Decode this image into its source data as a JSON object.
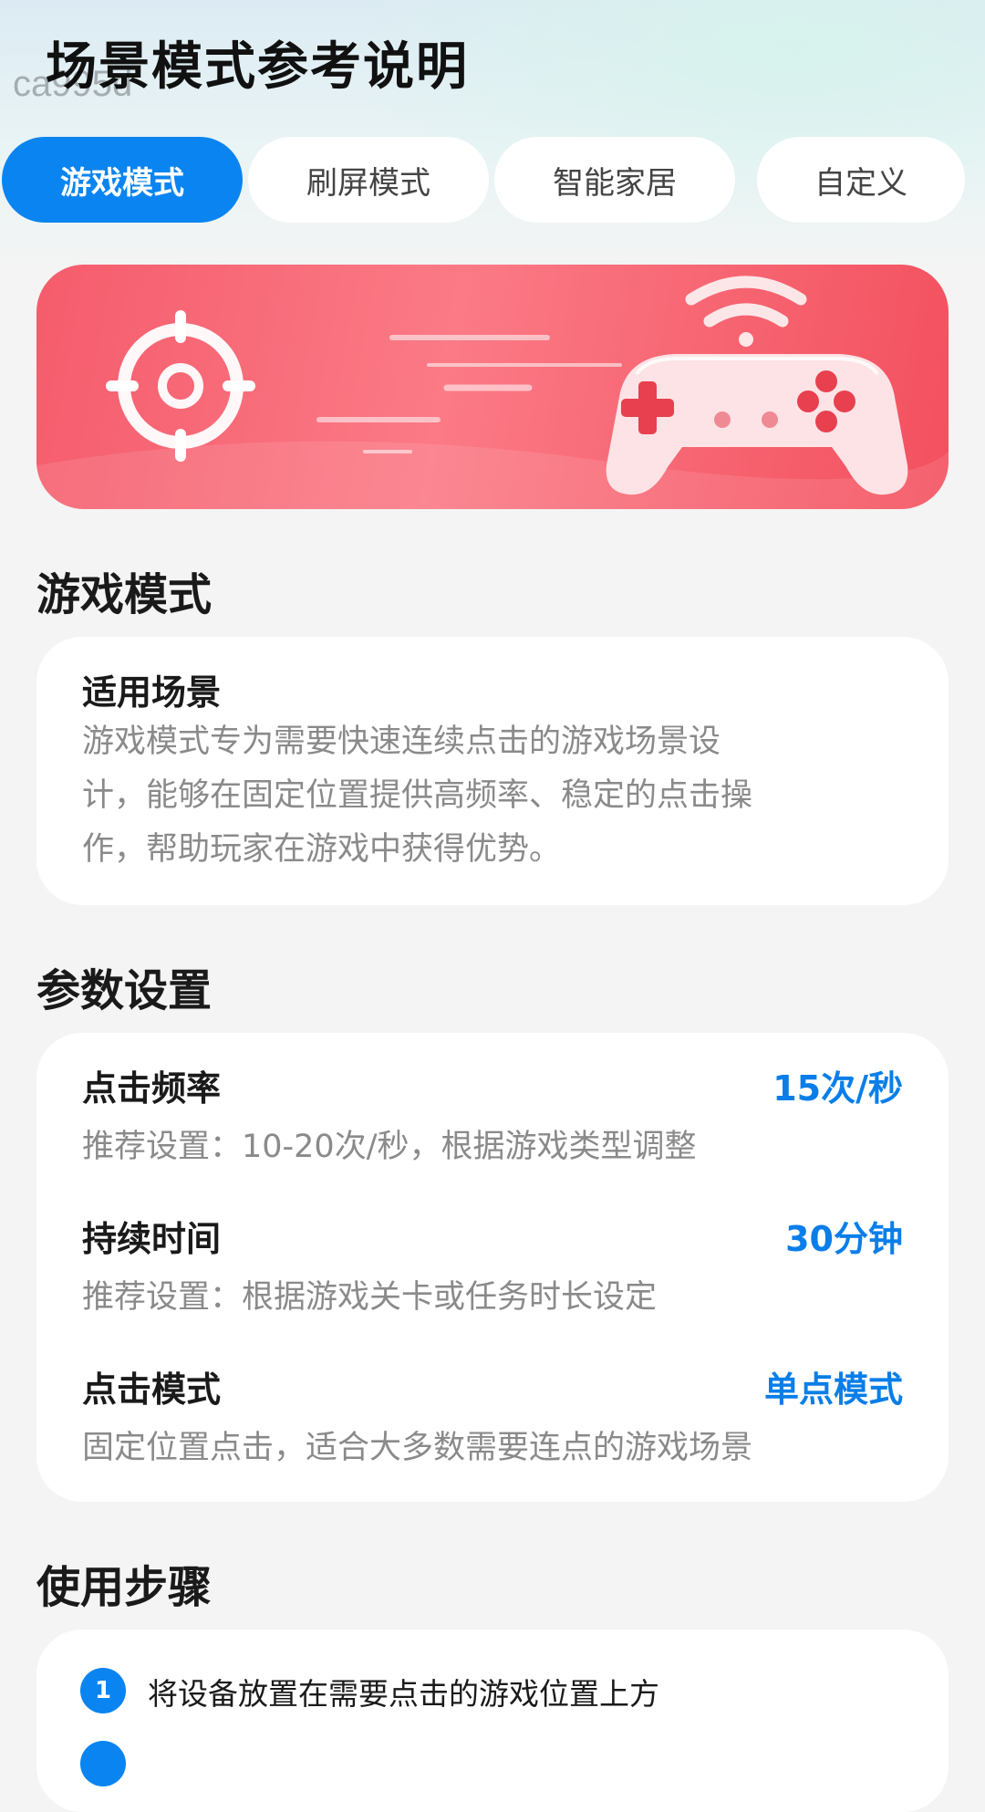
{
  "header": {
    "title": "场景模式参考说明",
    "watermark": "ca995d"
  },
  "tabs": [
    {
      "label": "游戏模式",
      "active": true
    },
    {
      "label": "刷屏模式",
      "active": false
    },
    {
      "label": "智能家居",
      "active": false
    },
    {
      "label": "自定义",
      "active": false
    }
  ],
  "banner": {
    "icons": [
      "crosshair-icon",
      "wifi-icon",
      "gamepad-icon"
    ],
    "colors": {
      "start": "#f55c6c",
      "end": "#f3505e"
    }
  },
  "mode_title": "游戏模式",
  "scenario": {
    "title": "适用场景",
    "lines": [
      "游戏模式专为需要快速连续点击的游戏场景设",
      "计，能够在固定位置提供高频率、稳定的点击操",
      "作，帮助玩家在游戏中获得优势。"
    ]
  },
  "params": {
    "title": "参数设置",
    "items": [
      {
        "name": "点击频率",
        "value": "15次/秒",
        "desc": "推荐设置：10-20次/秒，根据游戏类型调整"
      },
      {
        "name": "持续时间",
        "value": "30分钟",
        "desc": "推荐设置：根据游戏关卡或任务时长设定"
      },
      {
        "name": "点击模式",
        "value": "单点模式",
        "desc": "固定位置点击，适合大多数需要连点的游戏场景"
      }
    ]
  },
  "steps": {
    "title": "使用步骤",
    "items": [
      {
        "num": "1",
        "text": "将设备放置在需要点击的游戏位置上方"
      }
    ]
  },
  "colors": {
    "accent": "#0a84f0",
    "value_blue": "#0a7ee8",
    "banner": "#f55c6c"
  }
}
